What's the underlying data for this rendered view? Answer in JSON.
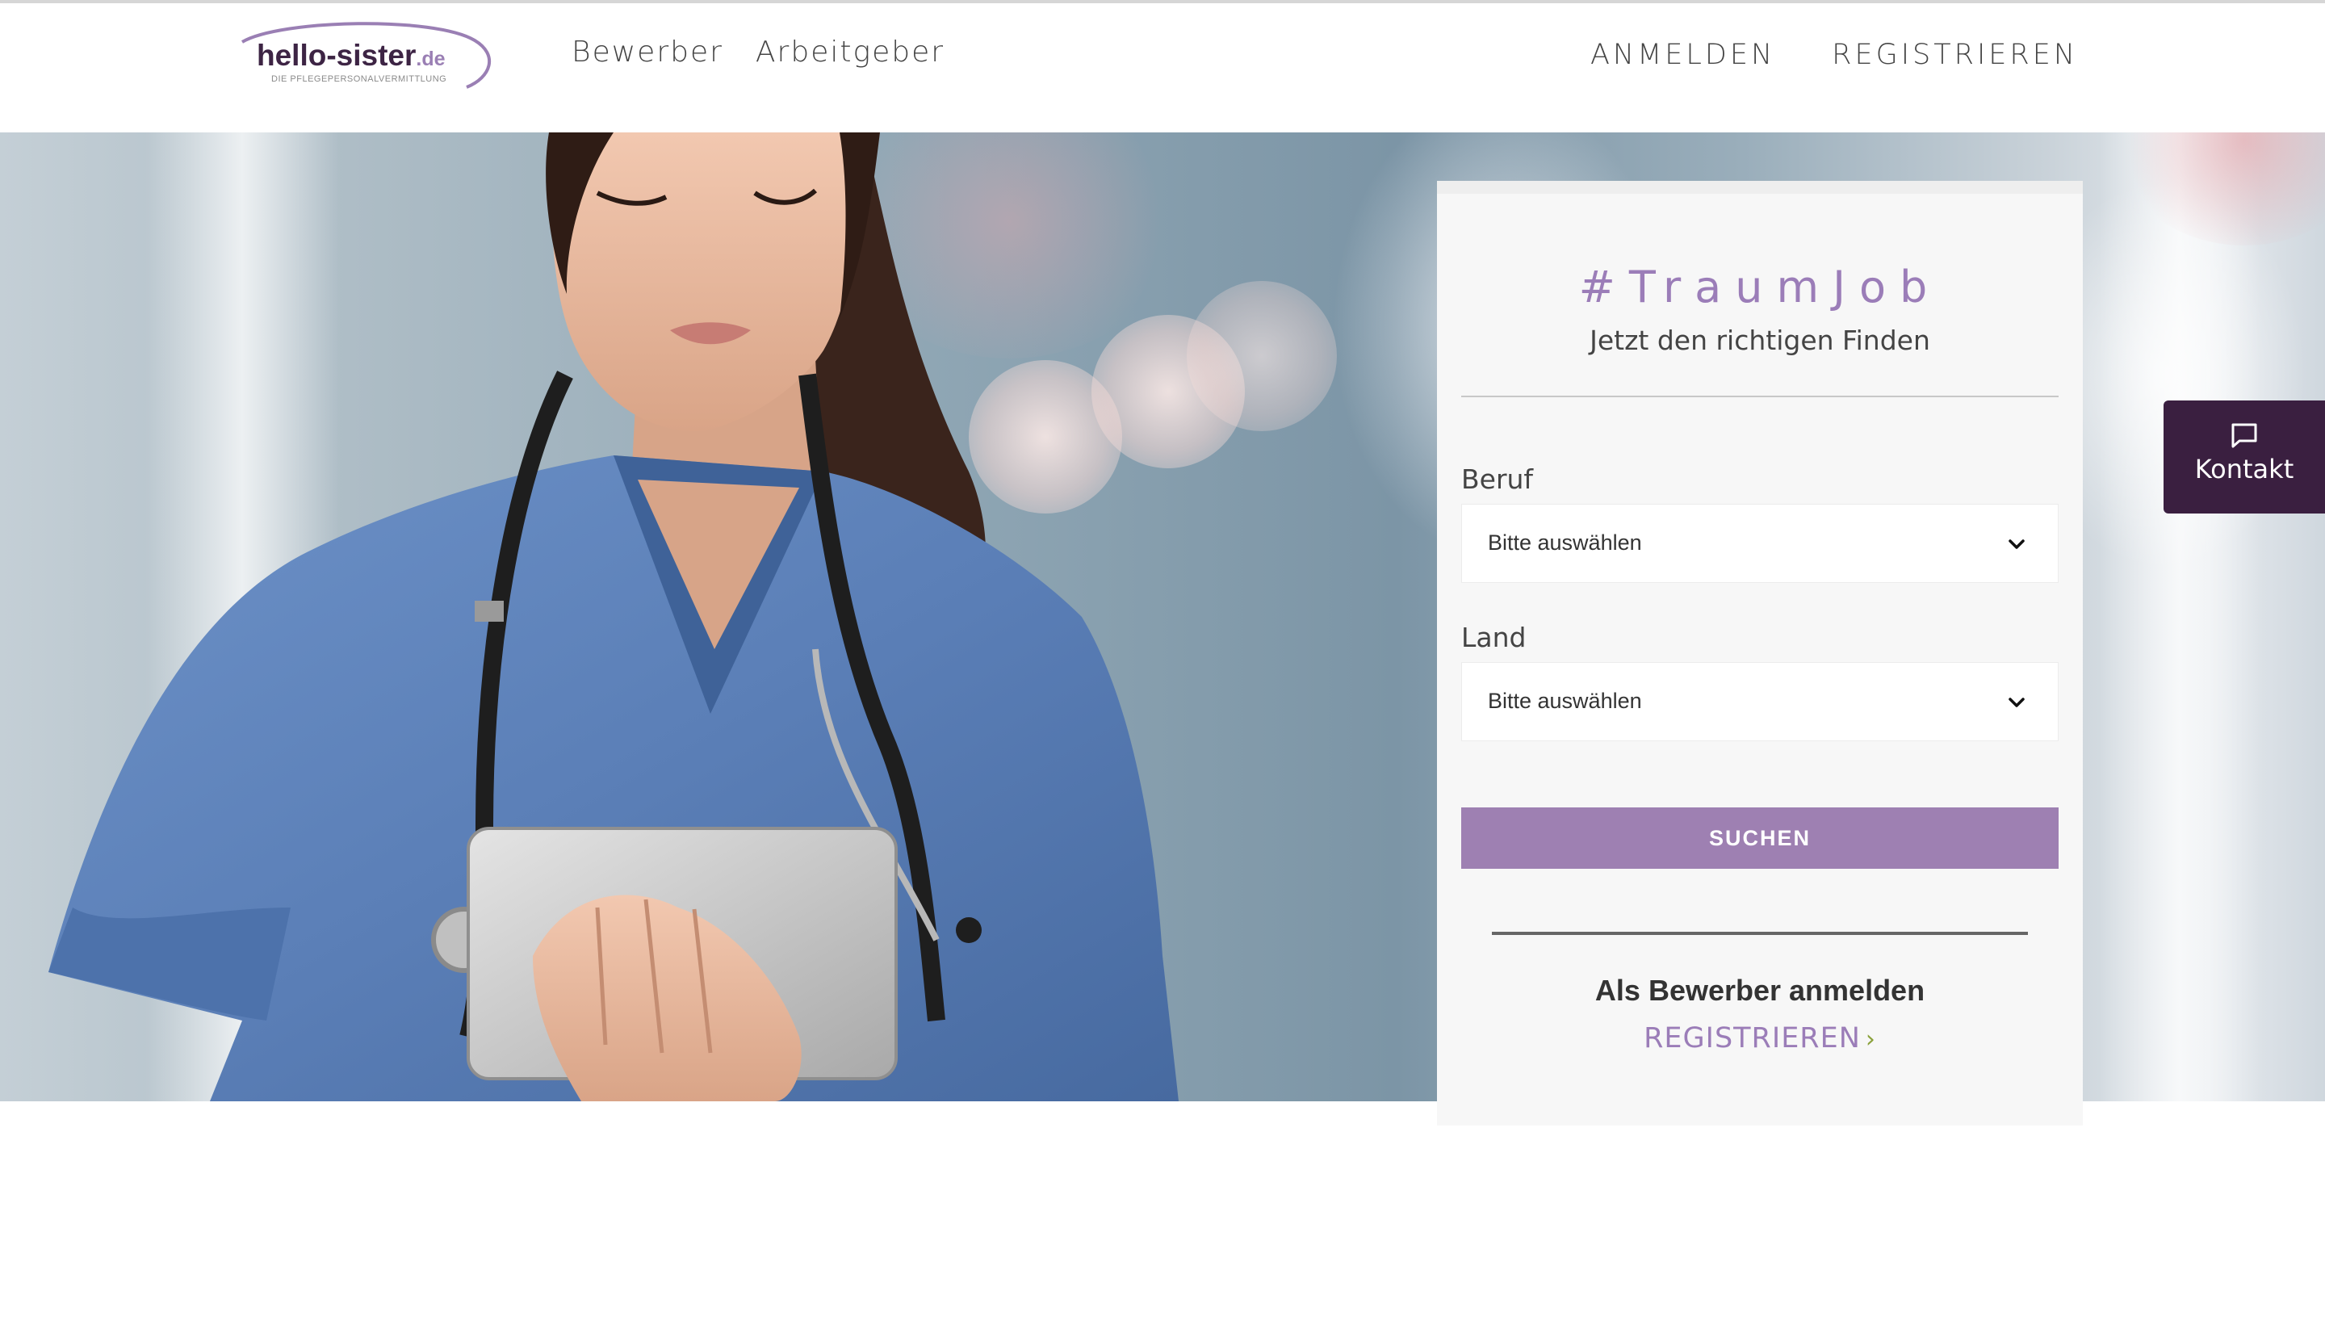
{
  "header": {
    "logo": {
      "name": "hello-sister",
      "domain": ".de",
      "tagline": "DIE PFLEGEPERSONALVERMITTLUNG"
    },
    "nav_left": [
      {
        "label": "Bewerber"
      },
      {
        "label": "Arbeitgeber"
      }
    ],
    "nav_right": [
      {
        "label": "ANMELDEN"
      },
      {
        "label": "REGISTRIEREN"
      }
    ]
  },
  "search_panel": {
    "title": "#TraumJob",
    "subtitle": "Jetzt den richtigen Finden",
    "fields": [
      {
        "label": "Beruf",
        "selected": "Bitte auswählen"
      },
      {
        "label": "Land",
        "selected": "Bitte auswählen"
      }
    ],
    "search_label": "SUCHEN",
    "login_heading": "Als Bewerber anmelden",
    "register_label": "REGISTRIEREN",
    "register_arrow": "›"
  },
  "kontakt": {
    "label": "Kontakt",
    "icon": "chat-bubble-icon"
  },
  "colors": {
    "brand_purple": "#9e80b2",
    "brand_dark": "#3a1f40",
    "accent_green": "#8aa13a"
  }
}
